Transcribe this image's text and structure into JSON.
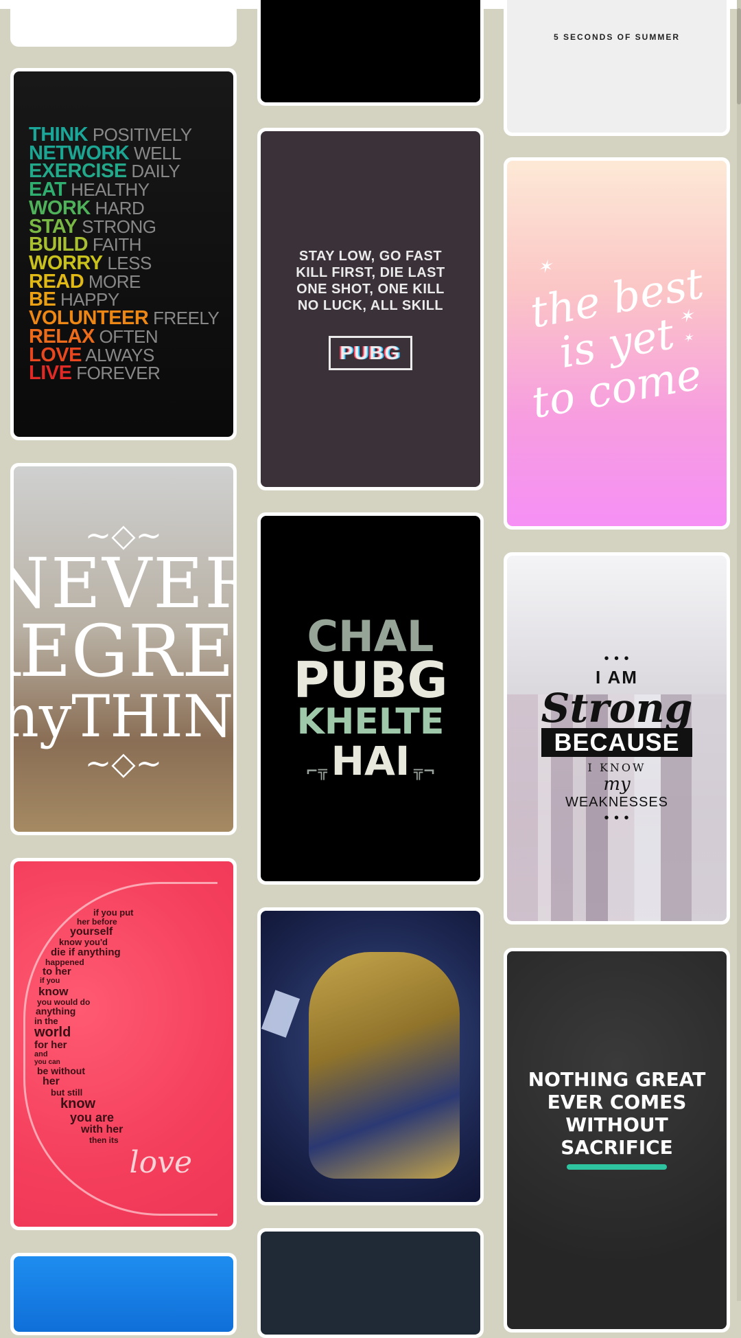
{
  "colors": {
    "page_bg": "#d4d3c1",
    "card_bg": "#ffffff"
  },
  "wallpapers": {
    "think": {
      "rows": [
        {
          "bold": "THINK",
          "light": "POSITIVELY",
          "color": "#1aa79a"
        },
        {
          "bold": "NETWORK",
          "light": "WELL",
          "color": "#1ca592"
        },
        {
          "bold": "EXERCISE",
          "light": "DAILY",
          "color": "#23a98a"
        },
        {
          "bold": "EAT",
          "light": "HEALTHY",
          "color": "#2fae70"
        },
        {
          "bold": "WORK",
          "light": "HARD",
          "color": "#4fb25a"
        },
        {
          "bold": "STAY",
          "light": "STRONG",
          "color": "#7ab845"
        },
        {
          "bold": "BUILD",
          "light": "FAITH",
          "color": "#a8bf32"
        },
        {
          "bold": "WORRY",
          "light": "LESS",
          "color": "#c9c21c"
        },
        {
          "bold": "READ",
          "light": "MORE",
          "color": "#e0b917"
        },
        {
          "bold": "BE",
          "light": "HAPPY",
          "color": "#e9a014"
        },
        {
          "bold": "VOLUNTEER",
          "light": "FREELY",
          "color": "#ec8716"
        },
        {
          "bold": "RELAX",
          "light": "OFTEN",
          "color": "#ec6c1b"
        },
        {
          "bold": "LOVE",
          "light": "ALWAYS",
          "color": "#e84820"
        },
        {
          "bold": "LIVE",
          "light": "FOREVER",
          "color": "#e02a26"
        }
      ]
    },
    "never": {
      "ornament": "~◇~",
      "line1": "NEVER",
      "line2": "REGRET",
      "line3": "anyTHING"
    },
    "heart": {
      "lines": [
        "if you put",
        "her before",
        "yourself",
        "know you'd",
        "die if anything",
        "happened",
        "to her",
        "if you",
        "know",
        "you would do",
        "anything",
        "in the",
        "world",
        "for her",
        "and",
        "you can",
        "be without",
        "her",
        "but still",
        "know",
        "you are",
        "with her",
        "then its"
      ],
      "love": "love"
    },
    "pubg_quote": {
      "lines": [
        "STAY LOW, GO FAST",
        "KILL FIRST, DIE LAST",
        "ONE SHOT, ONE KILL",
        "NO LUCK, ALL SKILL"
      ],
      "logo": "PUBG"
    },
    "chal": {
      "line1": "CHAL",
      "line2": "PUBG",
      "line3": "KHELTE",
      "line4": "HAI",
      "gun": "⌐╦"
    },
    "fivesos": {
      "brand": "5 SECONDS OF SUMMER"
    },
    "best": {
      "line1": "the best",
      "line2": "is yet",
      "line3": "to come",
      "star": "✶"
    },
    "strong": {
      "l1": "I AM",
      "l2": "Strong",
      "l3": "BECAUSE",
      "l4": "I KNOW",
      "l5": "my",
      "l6": "WEAKNESSES",
      "dots": "• • •"
    },
    "sacrifice": {
      "lines": [
        "NOTHING GREAT",
        "EVER COMES",
        "WITHOUT",
        "SACRIFICE"
      ]
    }
  }
}
